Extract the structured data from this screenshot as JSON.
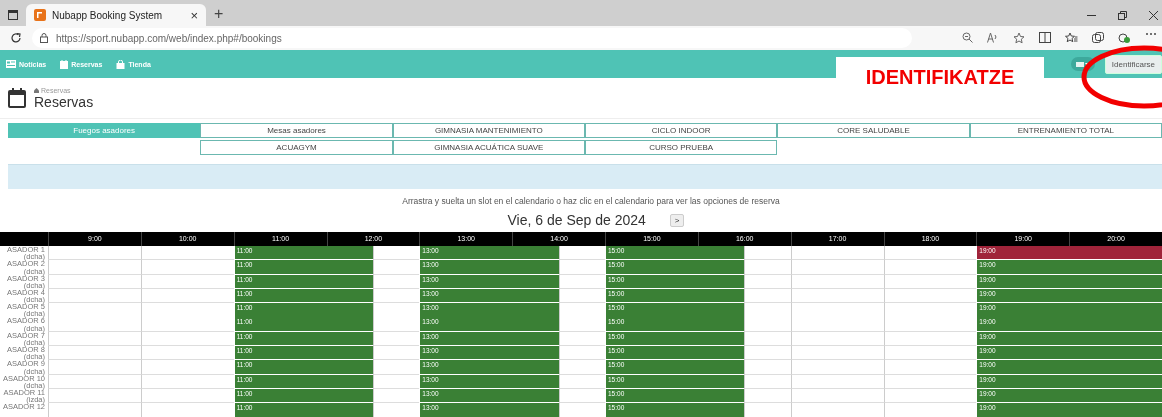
{
  "browser": {
    "tab_title": "Nubapp Booking System",
    "tab_close": "×",
    "new_tab": "+",
    "url": "https://sport.nubapp.com/web/index.php#/bookings"
  },
  "nav": {
    "items": [
      {
        "label": "Noticias",
        "kind": "news"
      },
      {
        "label": "Reservas",
        "kind": "calendar"
      },
      {
        "label": "Tienda",
        "kind": "bag"
      }
    ],
    "login": "Identificarse"
  },
  "annotation": {
    "text": "IDENTIFIKATZE"
  },
  "page": {
    "breadcrumb": "Reservas",
    "title": "Reservas"
  },
  "category_rows": [
    [
      {
        "label": "Fuegos asadores",
        "selected": true
      },
      {
        "label": "Mesas asadores",
        "selected": false
      },
      {
        "label": "GIMNASIA MANTENIMIENTO",
        "selected": false
      },
      {
        "label": "CICLO INDOOR",
        "selected": false
      },
      {
        "label": "CORE SALUDABLE",
        "selected": false
      },
      {
        "label": "ENTRENAMIENTO TOTAL",
        "selected": false
      }
    ],
    [
      {
        "label": "ACUAGYM",
        "selected": false
      },
      {
        "label": "GIMNASIA ACUÁTICA SUAVE",
        "selected": false
      },
      {
        "label": "CURSO PRUEBA",
        "selected": false
      }
    ]
  ],
  "instructions": "Arrastra y suelta un slot en el calendario o haz clic en el calendario para ver las opciones de reserva",
  "date": "Vie, 6 de Sep de 2024",
  "next": ">",
  "calendar": {
    "hours": [
      "9:00",
      "10:00",
      "11:00",
      "12:00",
      "13:00",
      "14:00",
      "15:00",
      "16:00",
      "17:00",
      "18:00",
      "19:00",
      "20:00"
    ],
    "rows": [
      {
        "name": "ASADOR 1",
        "side": "(dcha)",
        "slots": [
          {
            "start": "11:00",
            "booked": false
          },
          {
            "start": "13:00",
            "booked": false
          },
          {
            "start": "15:00",
            "booked": false
          },
          {
            "start": "19:00",
            "booked": true
          }
        ]
      },
      {
        "name": "ASADOR 2",
        "side": "(dcha)",
        "slots": [
          {
            "start": "11:00",
            "booked": false
          },
          {
            "start": "13:00",
            "booked": false
          },
          {
            "start": "15:00",
            "booked": false
          },
          {
            "start": "19:00",
            "booked": false
          }
        ]
      },
      {
        "name": "ASADOR 3",
        "side": "(dcha)",
        "slots": [
          {
            "start": "11:00",
            "booked": false
          },
          {
            "start": "13:00",
            "booked": false
          },
          {
            "start": "15:00",
            "booked": false
          },
          {
            "start": "19:00",
            "booked": false
          }
        ]
      },
      {
        "name": "ASADOR 4",
        "side": "(dcha)",
        "slots": [
          {
            "start": "11:00",
            "booked": false
          },
          {
            "start": "13:00",
            "booked": false
          },
          {
            "start": "15:00",
            "booked": false
          },
          {
            "start": "19:00",
            "booked": false
          }
        ]
      },
      {
        "name": "ASADOR 5",
        "side": "(dcha)",
        "slots": [
          {
            "start": "11:00",
            "booked": false
          },
          {
            "start": "13:00",
            "booked": false
          },
          {
            "start": "15:00",
            "booked": false
          },
          {
            "start": "19:00",
            "booked": false
          }
        ]
      },
      {
        "name": "ASADOR 6",
        "side": "(dcha)",
        "slots": [
          {
            "start": "11:00",
            "booked": false
          },
          {
            "start": "13:00",
            "booked": false
          },
          {
            "start": "15:00",
            "booked": false
          },
          {
            "start": "19:00",
            "booked": false
          }
        ]
      },
      {
        "name": "ASADOR 7",
        "side": "(dcha)",
        "slots": [
          {
            "start": "11:00",
            "booked": false
          },
          {
            "start": "13:00",
            "booked": false
          },
          {
            "start": "15:00",
            "booked": false
          },
          {
            "start": "19:00",
            "booked": false
          }
        ]
      },
      {
        "name": "ASADOR 8",
        "side": "(dcha)",
        "slots": [
          {
            "start": "11:00",
            "booked": false
          },
          {
            "start": "13:00",
            "booked": false
          },
          {
            "start": "15:00",
            "booked": false
          },
          {
            "start": "19:00",
            "booked": false
          }
        ]
      },
      {
        "name": "ASADOR 9",
        "side": "(dcha)",
        "slots": [
          {
            "start": "11:00",
            "booked": false
          },
          {
            "start": "13:00",
            "booked": false
          },
          {
            "start": "15:00",
            "booked": false
          },
          {
            "start": "19:00",
            "booked": false
          }
        ]
      },
      {
        "name": "ASADOR 10",
        "side": "(dcha)",
        "slots": [
          {
            "start": "11:00",
            "booked": false
          },
          {
            "start": "13:00",
            "booked": false
          },
          {
            "start": "15:00",
            "booked": false
          },
          {
            "start": "19:00",
            "booked": false
          }
        ]
      },
      {
        "name": "ASADOR 11",
        "side": "(izda)",
        "slots": [
          {
            "start": "11:00",
            "booked": false
          },
          {
            "start": "13:00",
            "booked": false
          },
          {
            "start": "15:00",
            "booked": false
          },
          {
            "start": "19:00",
            "booked": false
          }
        ]
      },
      {
        "name": "ASADOR 12",
        "slots": [
          {
            "start": "11:00",
            "booked": false
          },
          {
            "start": "13:00",
            "booked": false
          },
          {
            "start": "15:00",
            "booked": false
          },
          {
            "start": "19:00",
            "booked": false
          }
        ]
      }
    ]
  }
}
